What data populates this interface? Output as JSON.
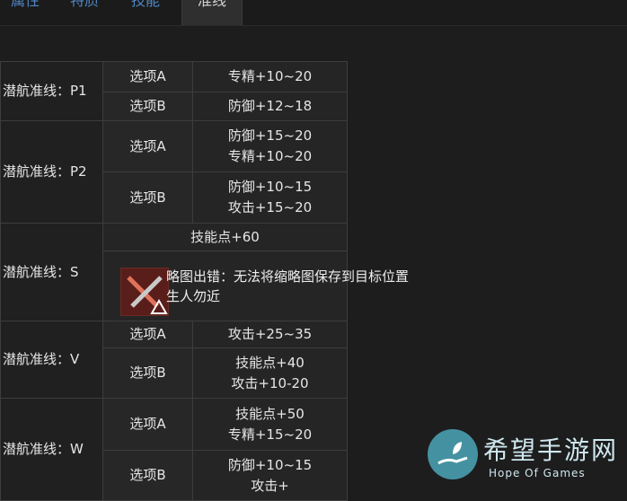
{
  "tabs": [
    "属性",
    "特质",
    "技能",
    "准线"
  ],
  "rows": [
    {
      "route": "潜航准线：P1",
      "options": [
        {
          "label": "选项A",
          "effects": [
            "专精+10~20"
          ]
        },
        {
          "label": "选项B",
          "effects": [
            "防御+12~18"
          ]
        }
      ]
    },
    {
      "route": "潜航准线：P2",
      "options": [
        {
          "label": "选项A",
          "effects": [
            "防御+15~20",
            "专精+10~20"
          ]
        },
        {
          "label": "选项B",
          "effects": [
            "防御+10~15",
            "攻击+15~20"
          ]
        }
      ]
    },
    {
      "route": "潜航准线：S",
      "shared_effect": "技能点+60"
    },
    {
      "route": "潜航准线：V",
      "options": [
        {
          "label": "选项A",
          "effects": [
            "攻击+25~35"
          ]
        },
        {
          "label": "选项B",
          "effects": [
            "技能点+40",
            "攻击+10-20"
          ]
        }
      ]
    },
    {
      "route": "潜航准线：W",
      "options": [
        {
          "label": "选项A",
          "effects": [
            "技能点+50",
            "专精+15~20"
          ]
        },
        {
          "label": "选项B",
          "effects": [
            "防御+10~15",
            "攻击+"
          ]
        }
      ]
    }
  ],
  "error_overlay": {
    "line1": "略图出错：无法将缩略图保存到目标位置",
    "line2": "生人勿近"
  },
  "watermark": {
    "title": "希望手游网",
    "subtitle": "Hope Of Games"
  }
}
